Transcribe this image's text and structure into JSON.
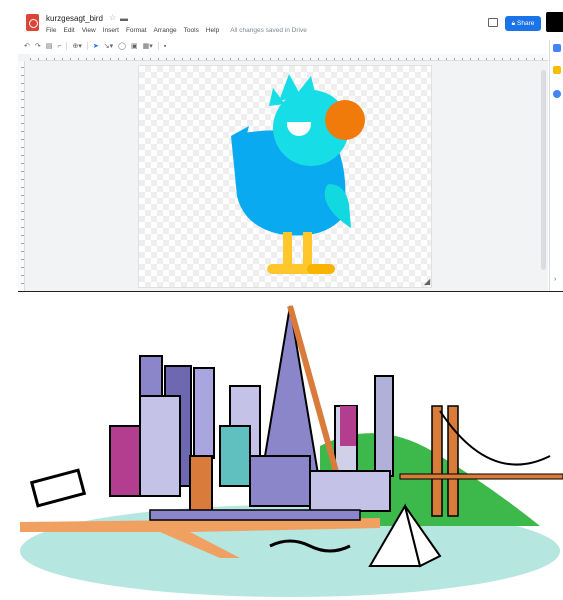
{
  "app": {
    "title": "kurzgesagt_bird",
    "star_icon": "star-outline-icon",
    "folder_icon": "folder-icon",
    "menu": [
      "File",
      "Edit",
      "View",
      "Insert",
      "Format",
      "Arrange",
      "Tools",
      "Help"
    ],
    "save_status": "All changes saved in Drive",
    "share_label": "Share",
    "share_icon": "lock-icon",
    "comments_icon": "comments-icon",
    "colors": {
      "share": "#1a73e8",
      "doc_icon": "#db4437"
    }
  },
  "toolbar": {
    "items": [
      "undo-icon",
      "redo-icon",
      "print-icon",
      "paint-format-icon",
      "zoom-icon",
      "select-icon",
      "line-icon",
      "shape-icon",
      "image-icon",
      "textbox-icon",
      "comment-icon"
    ]
  },
  "drawing": {
    "subject": "cartoon bird",
    "colors": {
      "body": "#0aaaf0",
      "head": "#16dde6",
      "beak": "#f07a0a",
      "legs": "#ffc72c",
      "feet": "#f8b400",
      "wing": "#12d8e0"
    }
  },
  "side_panel": {
    "icons": [
      "calendar-icon",
      "keep-icon",
      "tasks-icon"
    ]
  },
  "clipart": {
    "subject": "city skyline with bridge and sailboat",
    "colors": {
      "water": "#b5e6e0",
      "hill": "#3db84a",
      "bridge": "#d97b3a",
      "tower": "#8b86c9",
      "ground": "#f0a060"
    }
  }
}
